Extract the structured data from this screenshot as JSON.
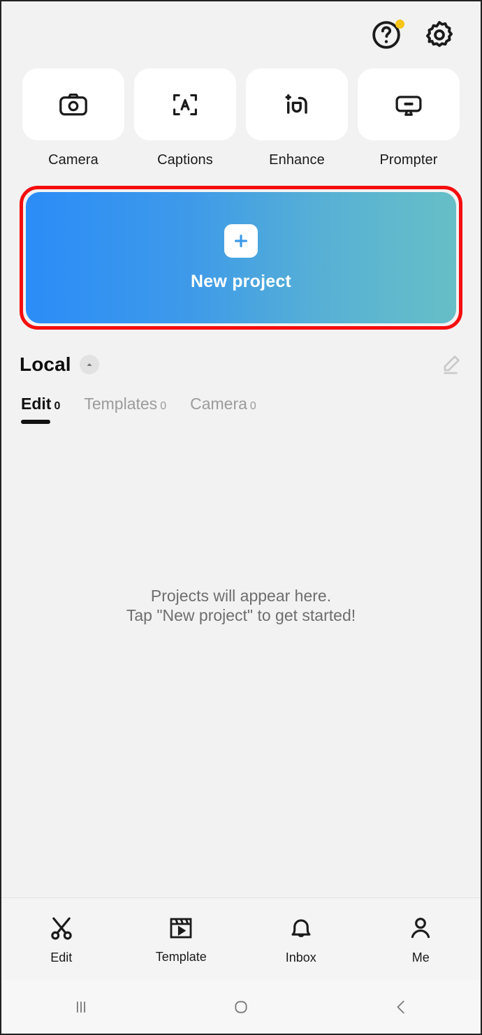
{
  "topbar": {
    "help": {
      "name": "help-icon",
      "has_badge": true,
      "badge_color": "#f5c518"
    },
    "settings": {
      "name": "gear-icon"
    }
  },
  "quick_actions": [
    {
      "label": "Camera",
      "icon": "camera-icon"
    },
    {
      "label": "Captions",
      "icon": "captions-scan-icon"
    },
    {
      "label": "Enhance",
      "icon": "enhance-sparkle-icon"
    },
    {
      "label": "Prompter",
      "icon": "prompter-monitor-icon"
    }
  ],
  "banner": {
    "label": "New project",
    "icon": "plus-icon",
    "gradient_from": "#2b8cf8",
    "gradient_to": "#66bfc6",
    "highlight_border_color": "#f50d0d"
  },
  "local_section": {
    "title": "Local",
    "collapse_icon": "chevron-up-icon",
    "edit_icon": "pencil-icon",
    "tabs": [
      {
        "label": "Edit",
        "count": "0",
        "active": true
      },
      {
        "label": "Templates",
        "count": "0",
        "active": false
      },
      {
        "label": "Camera",
        "count": "0",
        "active": false
      }
    ]
  },
  "empty_state": {
    "line1": "Projects will appear here.",
    "line2": "Tap \"New project\" to get started!"
  },
  "bottom_nav": [
    {
      "label": "Edit",
      "icon": "scissors-icon"
    },
    {
      "label": "Template",
      "icon": "clapperboard-icon"
    },
    {
      "label": "Inbox",
      "icon": "bell-icon"
    },
    {
      "label": "Me",
      "icon": "person-icon"
    }
  ],
  "system_bar": [
    {
      "name": "recents-button",
      "icon": "recents-icon"
    },
    {
      "name": "home-button",
      "icon": "home-circle-icon"
    },
    {
      "name": "back-button",
      "icon": "chevron-left-icon"
    }
  ]
}
